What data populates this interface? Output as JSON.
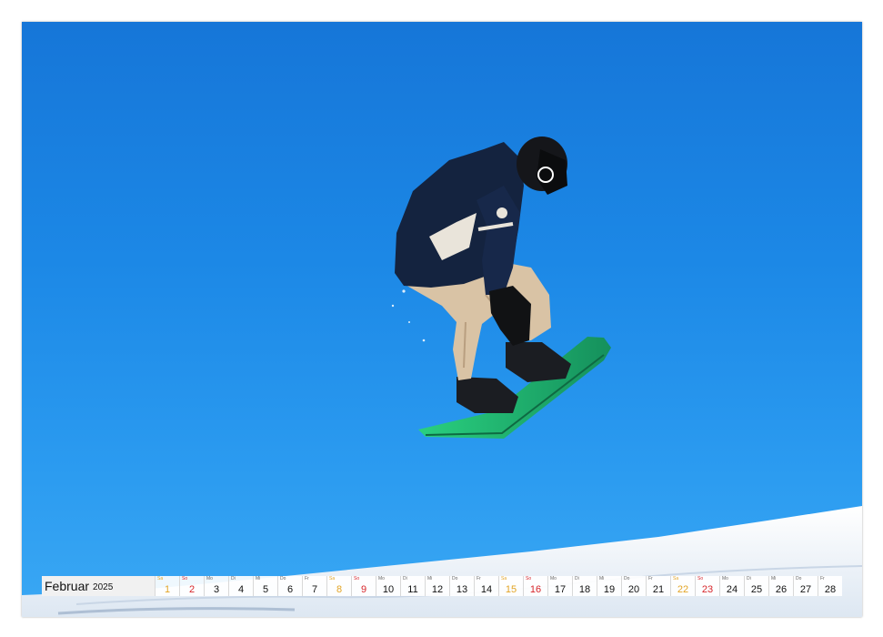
{
  "calendar": {
    "month": "Februar",
    "year": "2025",
    "days": [
      {
        "wd": "Sa",
        "n": "1",
        "type": "sat"
      },
      {
        "wd": "So",
        "n": "2",
        "type": "sun"
      },
      {
        "wd": "Mo",
        "n": "3",
        "type": "wk"
      },
      {
        "wd": "Di",
        "n": "4",
        "type": "wk"
      },
      {
        "wd": "Mi",
        "n": "5",
        "type": "wk"
      },
      {
        "wd": "Do",
        "n": "6",
        "type": "wk"
      },
      {
        "wd": "Fr",
        "n": "7",
        "type": "wk"
      },
      {
        "wd": "Sa",
        "n": "8",
        "type": "sat"
      },
      {
        "wd": "So",
        "n": "9",
        "type": "sun"
      },
      {
        "wd": "Mo",
        "n": "10",
        "type": "wk"
      },
      {
        "wd": "Di",
        "n": "11",
        "type": "wk"
      },
      {
        "wd": "Mi",
        "n": "12",
        "type": "wk"
      },
      {
        "wd": "Do",
        "n": "13",
        "type": "wk"
      },
      {
        "wd": "Fr",
        "n": "14",
        "type": "wk"
      },
      {
        "wd": "Sa",
        "n": "15",
        "type": "sat"
      },
      {
        "wd": "So",
        "n": "16",
        "type": "sun"
      },
      {
        "wd": "Mo",
        "n": "17",
        "type": "wk"
      },
      {
        "wd": "Di",
        "n": "18",
        "type": "wk"
      },
      {
        "wd": "Mi",
        "n": "19",
        "type": "wk"
      },
      {
        "wd": "Do",
        "n": "20",
        "type": "wk"
      },
      {
        "wd": "Fr",
        "n": "21",
        "type": "wk"
      },
      {
        "wd": "Sa",
        "n": "22",
        "type": "sat"
      },
      {
        "wd": "So",
        "n": "23",
        "type": "sun"
      },
      {
        "wd": "Mo",
        "n": "24",
        "type": "wk"
      },
      {
        "wd": "Di",
        "n": "25",
        "type": "wk"
      },
      {
        "wd": "Mi",
        "n": "26",
        "type": "wk"
      },
      {
        "wd": "Do",
        "n": "27",
        "type": "wk"
      },
      {
        "wd": "Fr",
        "n": "28",
        "type": "wk"
      }
    ]
  },
  "photo": {
    "subject": "snowboarder-jump",
    "colors": {
      "sky": "#1c88e6",
      "snow": "#f4f7fb",
      "jacket": "#14233f",
      "pants": "#d9c3a5",
      "board": "#1fc27a"
    }
  },
  "colors": {
    "saturday": "#e3a425",
    "sunday": "#d7262b"
  }
}
